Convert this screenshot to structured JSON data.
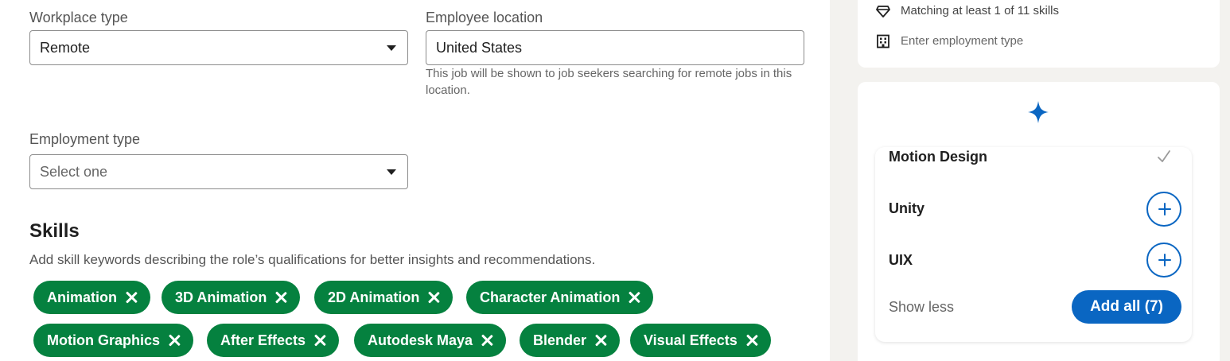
{
  "form": {
    "workplace_type": {
      "label": "Workplace type",
      "value": "Remote"
    },
    "employee_location": {
      "label": "Employee location",
      "value": "United States",
      "hint": "This job will be shown to job seekers searching for remote jobs in this location."
    },
    "employment_type": {
      "label": "Employment type",
      "placeholder": "Select one"
    }
  },
  "skills": {
    "heading": "Skills",
    "description": "Add skill keywords describing the role’s qualifications for better insights and recommendations.",
    "pills": [
      "Animation",
      "3D Animation",
      "2D Animation",
      "Character Animation",
      "Motion Graphics",
      "After Effects",
      "Autodesk Maya",
      "Blender",
      "Visual Effects"
    ]
  },
  "sidebar": {
    "match_text": "Matching at least 1 of 11 skills",
    "employment_text": "Enter employment type",
    "suggestions": [
      {
        "name": "Motion Design",
        "state": "added"
      },
      {
        "name": "Unity",
        "state": "add"
      },
      {
        "name": "UIX",
        "state": "add"
      }
    ],
    "show_less": "Show less",
    "add_all": "Add all (7)"
  },
  "colors": {
    "pill_green": "#05813f",
    "brand_blue": "#0a66c2"
  }
}
